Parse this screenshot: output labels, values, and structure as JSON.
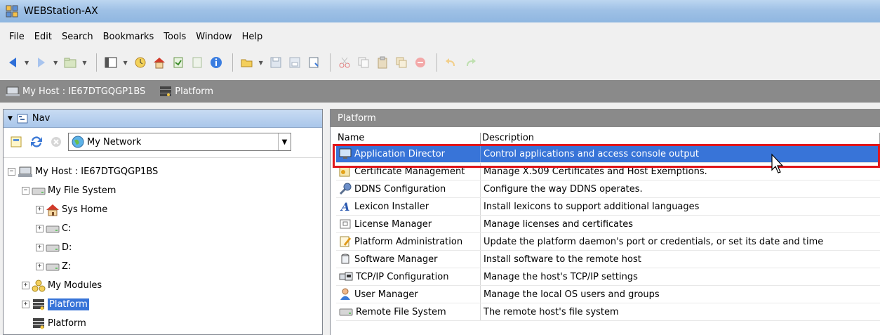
{
  "window": {
    "title": "WEBStation-AX"
  },
  "menu": [
    "File",
    "Edit",
    "Search",
    "Bookmarks",
    "Tools",
    "Window",
    "Help"
  ],
  "locator": [
    {
      "label": "My Host : IE67DTGQGP1BS",
      "icon": "host-icon"
    },
    {
      "label": "Platform",
      "icon": "platform-icon"
    }
  ],
  "nav": {
    "header": "Nav",
    "combo_value": "My Network",
    "tree": [
      {
        "label": "My Host : IE67DTGQGP1BS",
        "icon": "host-icon",
        "depth": 0,
        "expander": "−"
      },
      {
        "label": "My File System",
        "icon": "drive-icon",
        "depth": 1,
        "expander": "−"
      },
      {
        "label": "Sys Home",
        "icon": "home-icon",
        "depth": 2,
        "expander": "+"
      },
      {
        "label": "C:",
        "icon": "drive-icon",
        "depth": 2,
        "expander": "+"
      },
      {
        "label": "D:",
        "icon": "drive-icon",
        "depth": 2,
        "expander": "+"
      },
      {
        "label": "Z:",
        "icon": "drive-icon",
        "depth": 2,
        "expander": "+"
      },
      {
        "label": "My Modules",
        "icon": "modules-icon",
        "depth": 1,
        "expander": "+"
      },
      {
        "label": "Platform",
        "icon": "platform-icon",
        "depth": 1,
        "expander": "+",
        "selected": true
      },
      {
        "label": "Platform",
        "icon": "platform-icon",
        "depth": 1,
        "expander": ""
      }
    ]
  },
  "table": {
    "title": "Platform",
    "columns": {
      "name": "Name",
      "description": "Description"
    },
    "rows": [
      {
        "name": "Application Director",
        "description": "Control applications and access console output",
        "icon": "monitor-icon",
        "selected": true
      },
      {
        "name": "Certificate Management",
        "description": "Manage X.509 Certificates and Host Exemptions.",
        "icon": "certificate-icon"
      },
      {
        "name": "DDNS Configuration",
        "description": "Configure the way DDNS operates.",
        "icon": "ddns-icon"
      },
      {
        "name": "Lexicon Installer",
        "description": "Install lexicons to support additional languages",
        "icon": "lexicon-icon"
      },
      {
        "name": "License Manager",
        "description": "Manage licenses and certificates",
        "icon": "license-icon"
      },
      {
        "name": "Platform Administration",
        "description": "Update the platform daemon's port or credentials, or set its date and time",
        "icon": "admin-icon"
      },
      {
        "name": "Software Manager",
        "description": "Install software to the remote host",
        "icon": "software-icon"
      },
      {
        "name": "TCP/IP Configuration",
        "description": "Manage the host's TCP/IP settings",
        "icon": "network-icon"
      },
      {
        "name": "User Manager",
        "description": "Manage the local OS users and groups",
        "icon": "user-icon"
      },
      {
        "name": "Remote File System",
        "description": "The remote host's file system",
        "icon": "drive-icon"
      }
    ]
  },
  "colors": {
    "selection": "#3874d8",
    "highlight": "#e0161b",
    "locator_bg": "#8a8a8a"
  }
}
